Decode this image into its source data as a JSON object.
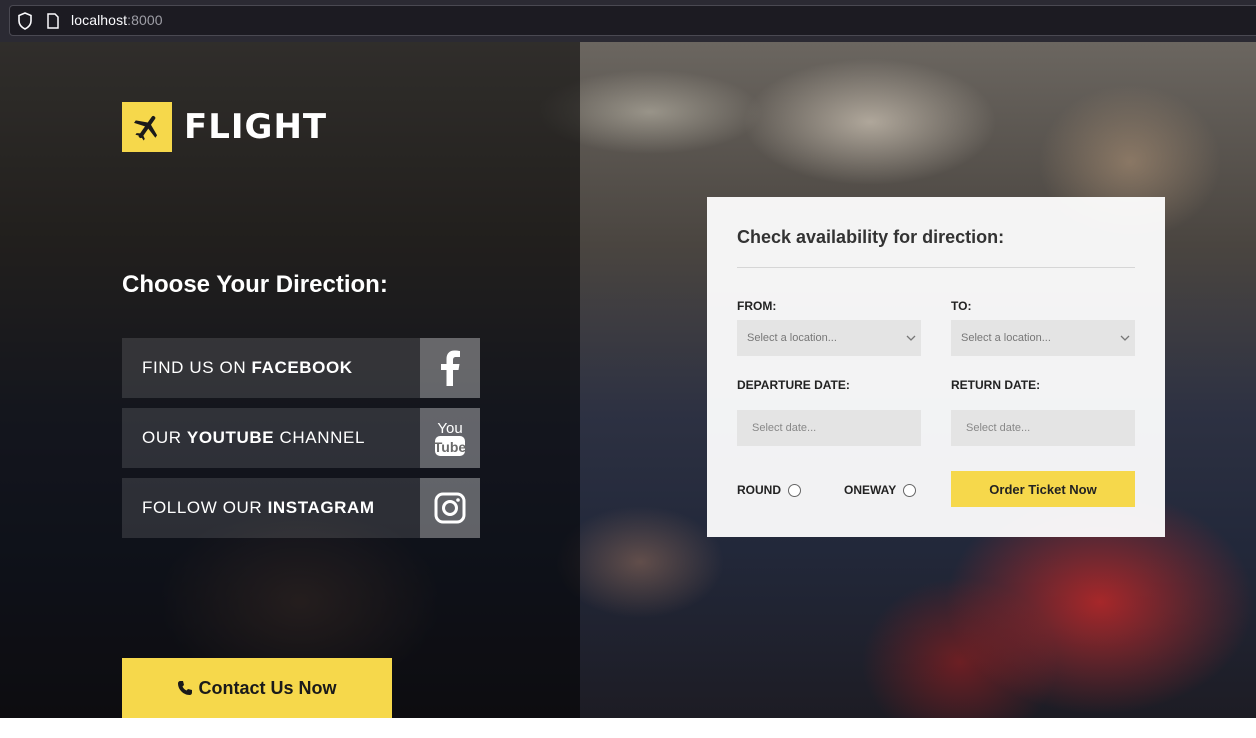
{
  "browser": {
    "url_host": "localhost",
    "url_port": ":8000"
  },
  "brand": {
    "name": "FLIGHT",
    "accent_color": "#f6d84b"
  },
  "left": {
    "title": "Choose Your Direction:",
    "social": [
      {
        "pre": "FIND US ON ",
        "bold": "FACEBOOK",
        "post": "",
        "icon": "facebook-icon"
      },
      {
        "pre": "OUR ",
        "bold": "YOUTUBE",
        "post": " CHANNEL",
        "icon": "youtube-icon"
      },
      {
        "pre": "FOLLOW OUR ",
        "bold": "INSTAGRAM",
        "post": "",
        "icon": "instagram-icon"
      }
    ],
    "contact_label": "Contact Us Now"
  },
  "form": {
    "title": "Check availability for direction:",
    "from_label": "FROM:",
    "to_label": "TO:",
    "from_value": "Select a location...",
    "to_value": "Select a location...",
    "departure_label": "DEPARTURE DATE:",
    "return_label": "RETURN DATE:",
    "departure_placeholder": "Select date...",
    "return_placeholder": "Select date...",
    "round_label": "ROUND",
    "oneway_label": "ONEWAY",
    "order_label": "Order Ticket Now"
  }
}
